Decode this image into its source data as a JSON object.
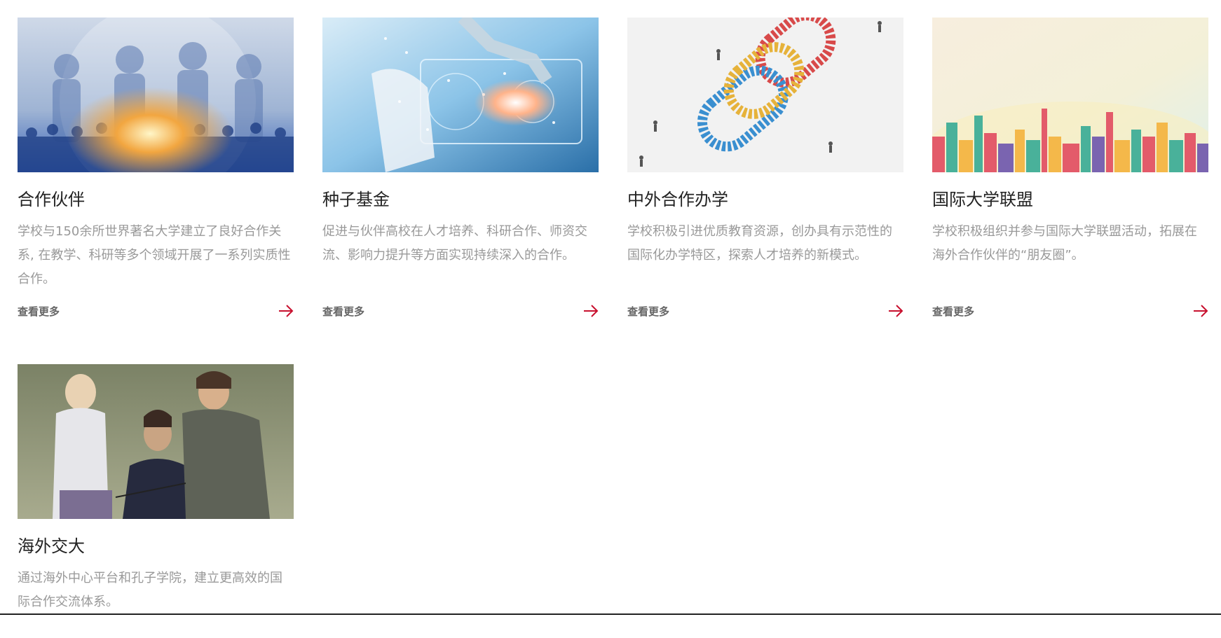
{
  "cards": [
    {
      "title": "合作伙伴",
      "desc": "学校与150余所世界著名大学建立了良好合作关系, 在教学、科研等多个领域开展了一系列实质性合作。",
      "more": "查看更多",
      "image": "partners-crowd-image"
    },
    {
      "title": "种子基金",
      "desc": "促进与伙伴高校在人才培养、科研合作、师资交流、影响力提升等方面实现持续深入的合作。",
      "more": "查看更多",
      "image": "seed-fund-tech-image"
    },
    {
      "title": "中外合作办学",
      "desc": "学校积极引进优质教育资源，创办具有示范性的国际化办学特区，探索人才培养的新模式。",
      "more": "查看更多",
      "image": "chain-link-people-image"
    },
    {
      "title": "国际大学联盟",
      "desc": "学校积极组织并参与国际大学联盟活动，拓展在海外合作伙伴的“朋友圈”。",
      "more": "查看更多",
      "image": "city-skyline-image"
    },
    {
      "title": "海外交大",
      "desc": "通过海外中心平台和孔子学院，建立更高效的国际合作交流体系。",
      "more": "",
      "image": "overseas-students-image"
    }
  ],
  "colors": {
    "accent": "#c8102e",
    "title": "#222222",
    "desc": "#999999",
    "more": "#666666"
  }
}
